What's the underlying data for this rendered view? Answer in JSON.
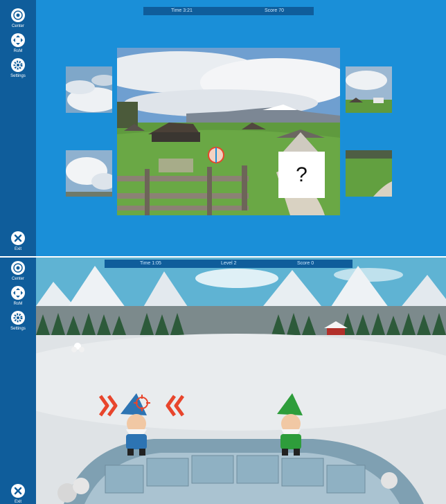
{
  "sidebar": {
    "items": [
      {
        "label": "Center",
        "icon": "target-icon"
      },
      {
        "label": "RoM",
        "icon": "move-icon"
      },
      {
        "label": "Settings",
        "icon": "gear-icon"
      }
    ],
    "exit_label": "Exit"
  },
  "puzzle": {
    "time": "Time  3:21",
    "score": "Score  70",
    "missing_piece": "?"
  },
  "snow_game": {
    "time": "Time  1:05",
    "level": "Level 2",
    "score": "Score  0"
  },
  "colors": {
    "accent_blue": "#1a8fd8",
    "sidebar_blue": "#0f5d9b",
    "arrow_red": "#e8452c"
  }
}
